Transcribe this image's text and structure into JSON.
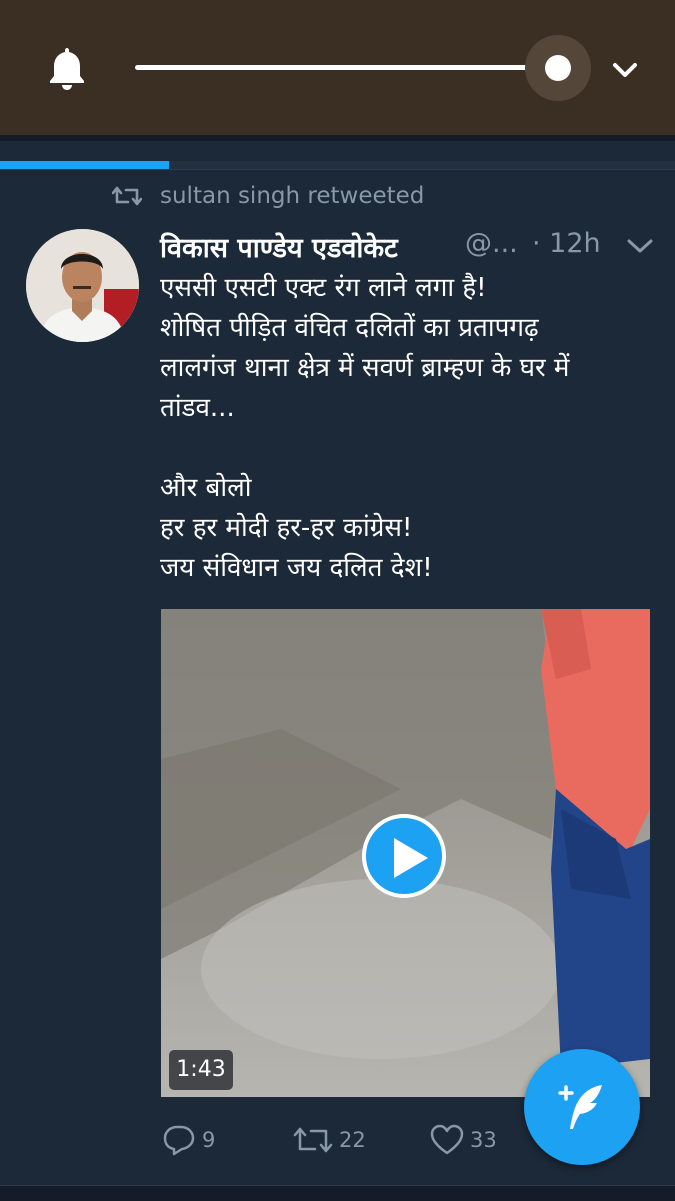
{
  "media_bar": {
    "bell_icon": "bell-icon",
    "progress": 1.0,
    "expand_icon": "chevron-down-icon"
  },
  "feed": {
    "loading_progress": 0.25
  },
  "retweet_banner": {
    "icon": "retweet-icon",
    "label": "sultan singh retweeted"
  },
  "tweet": {
    "author_name": "विकास पाण्डेय एडवोकेट",
    "handle": "@...",
    "time": "· 12h",
    "menu_icon": "chevron-down-icon",
    "text_lines": [
      "एससी एसटी एक्ट रंग लाने लगा है!",
      "शोषित पीड़ित वंचित दलितों का प्रतापगढ़",
      "लालगंज थाना क्षेत्र में सवर्ण ब्राम्हण के घर में",
      "तांडव...",
      "",
      "और बोलो",
      "हर हर मोदी हर-हर कांग्रेस!",
      "जय संविधान जय दलित देश!"
    ],
    "video": {
      "duration": "1:43",
      "play_icon": "play-icon"
    },
    "actions": {
      "reply_count": "9",
      "retweet_count": "22",
      "like_count": "33"
    }
  },
  "compose_button": {
    "icon": "compose-feather-icon"
  },
  "colors": {
    "background": "#1c2938",
    "topbar": "#3b2e22",
    "accent": "#1da1f2",
    "secondary_text": "#8899a6"
  }
}
